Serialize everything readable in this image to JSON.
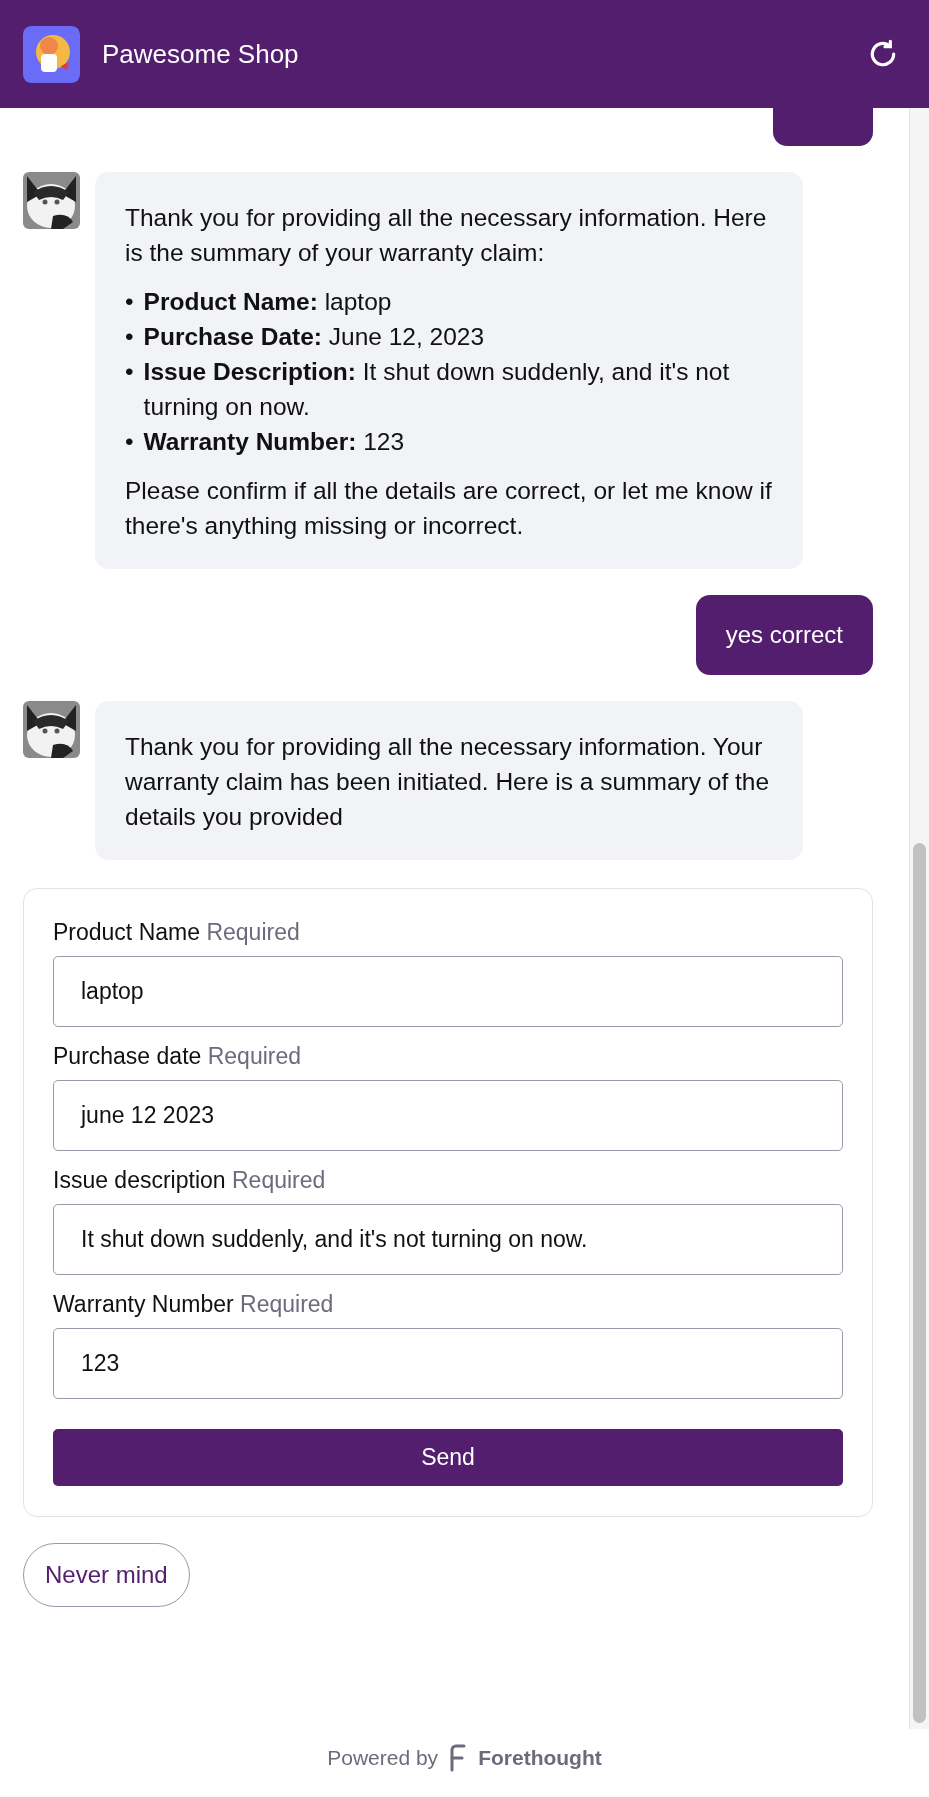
{
  "header": {
    "title": "Pawesome Shop"
  },
  "messages": [
    {
      "kind": "user"
    },
    {
      "kind": "bot",
      "paragraphs": [
        "Thank you for providing all the necessary information. Here is the summary of your warranty claim:"
      ],
      "list": [
        {
          "marker": "•",
          "text": "**Product Name:** laptop"
        },
        {
          "marker": "•",
          "text": "**Purchase Date:** June 12, 2023"
        },
        {
          "marker": "•",
          "text": "**Issue Description:** It shut down suddenly, and it's not turning on now."
        },
        {
          "marker": "•",
          "text": "**Warranty Number:** 123"
        }
      ],
      "closing": "Please confirm if all the details are correct, or let me know if there's anything missing or incorrect."
    },
    {
      "kind": "user",
      "text": "yes correct"
    },
    {
      "kind": "bot",
      "paragraphs": [
        "Thank you for providing all the necessary information. Your warranty claim has been initiated. Here is a summary of the details you provided"
      ]
    }
  ],
  "form": {
    "fields": [
      {
        "label": "Product Name",
        "hint": "Required",
        "value": "laptop"
      },
      {
        "label": "Purchase date",
        "hint": "Required",
        "value": "june 12 2023"
      },
      {
        "label": "Issue description",
        "hint": "Required",
        "value": "It shut down suddenly, and it's not turning on now."
      },
      {
        "label": "Warranty Number",
        "hint": "Required",
        "value": "123"
      }
    ],
    "submit": "Send"
  },
  "quick_reply": "Never mind",
  "footer": {
    "powered_by": "Powered by",
    "brand": "Forethought"
  }
}
